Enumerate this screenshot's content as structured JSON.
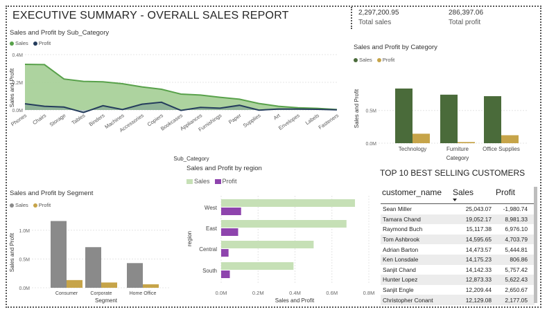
{
  "header": {
    "title": "EXECUTIVE SUMMARY - OVERALL SALES REPORT"
  },
  "kpis": {
    "total_sales": {
      "value": "2,297,200.95",
      "label": "Total sales"
    },
    "total_profit": {
      "value": "286,397.06",
      "label": "Total profit"
    }
  },
  "colors": {
    "sales_green": "#58a14a",
    "sales_area": "#a9d19a",
    "profit_navy": "#243c5c",
    "cat_sales": "#4a6b3a",
    "cat_profit": "#c6a449",
    "seg_sales": "#8a8a8a",
    "region_sales": "#c6e0b6",
    "region_profit": "#8e44ad"
  },
  "chart_data": [
    {
      "id": "subcategory",
      "type": "area",
      "title": "Sales and Profit by Sub_Category",
      "xlabel": "Sub_Category",
      "ylabel": "Sales and Profit",
      "legend": [
        "Sales",
        "Profit"
      ],
      "ylim": [
        -0.05,
        0.4
      ],
      "y_ticks": [
        "0.4M",
        "0.2M",
        "0.0M"
      ],
      "categories": [
        "Phones",
        "Chairs",
        "Storage",
        "Tables",
        "Binders",
        "Machines",
        "Accessories",
        "Copiers",
        "Bookcases",
        "Appliances",
        "Furnishings",
        "Paper",
        "Supplies",
        "Art",
        "Envelopes",
        "Labels",
        "Fasteners"
      ],
      "series": [
        {
          "name": "Sales",
          "values": [
            0.33,
            0.328,
            0.224,
            0.207,
            0.204,
            0.19,
            0.167,
            0.15,
            0.115,
            0.108,
            0.092,
            0.078,
            0.047,
            0.027,
            0.016,
            0.012,
            0.003
          ]
        },
        {
          "name": "Profit",
          "values": [
            0.045,
            0.027,
            0.021,
            -0.018,
            0.031,
            0.003,
            0.042,
            0.056,
            -0.003,
            0.019,
            0.013,
            0.034,
            -0.001,
            0.007,
            0.007,
            0.005,
            0.001
          ]
        }
      ]
    },
    {
      "id": "category",
      "type": "bar",
      "title": "Sales and Profit by Category",
      "xlabel": "Category",
      "ylabel": "Sales and Profit",
      "legend": [
        "Sales",
        "Profit"
      ],
      "ylim": [
        0,
        1.1
      ],
      "y_ticks": [
        "0.5M",
        "0.0M"
      ],
      "categories": [
        "Technology",
        "Furniture",
        "Office Supplies"
      ],
      "series": [
        {
          "name": "Sales",
          "values": [
            0.836,
            0.742,
            0.719
          ]
        },
        {
          "name": "Profit",
          "values": [
            0.145,
            0.018,
            0.122
          ]
        }
      ]
    },
    {
      "id": "segment",
      "type": "bar",
      "title": "Sales and Profit by Segment",
      "xlabel": "Segment",
      "ylabel": "Sales and Profit",
      "legend": [
        "Sales",
        "Profit"
      ],
      "ylim": [
        0,
        1.25
      ],
      "y_ticks": [
        "1.0M",
        "0.5M",
        "0.0M"
      ],
      "categories": [
        "Consumer",
        "Corporate",
        "Home Office"
      ],
      "series": [
        {
          "name": "Sales",
          "values": [
            1.16,
            0.706,
            0.429
          ]
        },
        {
          "name": "Profit",
          "values": [
            0.134,
            0.092,
            0.061
          ]
        }
      ]
    },
    {
      "id": "region",
      "type": "bar",
      "orientation": "horizontal",
      "title": "Sales and Profit by region",
      "xlabel": "Sales and Profit",
      "ylabel": "region",
      "legend": [
        "Sales",
        "Profit"
      ],
      "xlim": [
        0,
        0.8
      ],
      "x_ticks": [
        "0.0M",
        "0.2M",
        "0.4M",
        "0.6M",
        "0.8M"
      ],
      "categories": [
        "West",
        "East",
        "Central",
        "South"
      ],
      "series": [
        {
          "name": "Sales",
          "values": [
            0.725,
            0.679,
            0.501,
            0.392
          ]
        },
        {
          "name": "Profit",
          "values": [
            0.108,
            0.092,
            0.04,
            0.047
          ]
        }
      ]
    }
  ],
  "customers_table": {
    "title": "TOP 10 BEST SELLING CUSTOMERS",
    "columns": [
      "customer_name",
      "Sales",
      "Profit"
    ],
    "rows": [
      [
        "Sean Miller",
        "25,043.07",
        "-1,980.74"
      ],
      [
        "Tamara Chand",
        "19,052.17",
        "8,981.33"
      ],
      [
        "Raymond Buch",
        "15,117.38",
        "6,976.10"
      ],
      [
        "Tom Ashbrook",
        "14,595.65",
        "4,703.79"
      ],
      [
        "Adrian Barton",
        "14,473.57",
        "5,444.81"
      ],
      [
        "Ken Lonsdale",
        "14,175.23",
        "806.86"
      ],
      [
        "Sanjit Chand",
        "14,142.33",
        "5,757.42"
      ],
      [
        "Hunter Lopez",
        "12,873.33",
        "5,622.43"
      ],
      [
        "Sanjit Engle",
        "12,209.44",
        "2,650.67"
      ],
      [
        "Christopher Conant",
        "12,129.08",
        "2,177.05"
      ]
    ]
  }
}
